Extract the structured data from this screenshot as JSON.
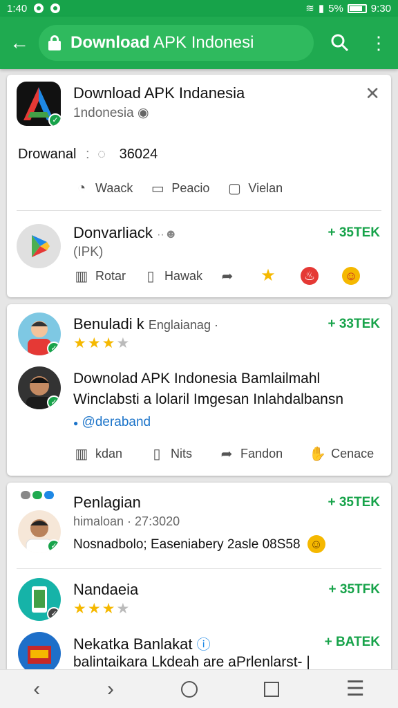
{
  "status_bar": {
    "time_left": "1:40",
    "battery": "5%",
    "time_right": "9:30"
  },
  "toolbar": {
    "title_bold": "Download",
    "title_rest": " APK Indonesi"
  },
  "featured": {
    "name": "Download APK Indanesia",
    "region": "1ndonesia",
    "downloads_label": "Drowanal",
    "downloads_count": "36024",
    "actions": [
      "Waack",
      "Peacio",
      "Vielan"
    ]
  },
  "playstore_row": {
    "name": "Donvarliack",
    "type": "(IPK)",
    "badge": "+ 35TEK",
    "actions": [
      "Rotar",
      "Hawak"
    ]
  },
  "card2": {
    "user1": {
      "name": "Benuladi k",
      "meta": "Englaianag ·",
      "badge": "+ 33TEK",
      "rating": 3
    },
    "post": {
      "line1": "Downolad APK Indonesia Bamlailmahl",
      "line2": "Winclabsti a lolaril Imgesan Inlahdalbansn",
      "handle": "@deraband",
      "actions": [
        "kdan",
        "Nits",
        "Fandon",
        "Cenace"
      ]
    }
  },
  "card3": {
    "item1": {
      "name": "Penlagian",
      "meta": "himaloan · 27:3020",
      "badge": "+ 35TEK",
      "text": "Nosnadbolo; Easeniabery  2asle 08S58"
    },
    "item2": {
      "name": "Nandaeia",
      "badge": "+ 35TFK",
      "rating": 3
    },
    "item3": {
      "name": "Nekatka Banlakat",
      "badge": "+ BATEK",
      "text": "balintaikara Lkdeah are aPrlenlarst- |"
    }
  },
  "colors": {
    "brand": "#1faa50",
    "status_bar": "#17a34a",
    "accent": "#17a34a",
    "star": "#f5b800"
  }
}
